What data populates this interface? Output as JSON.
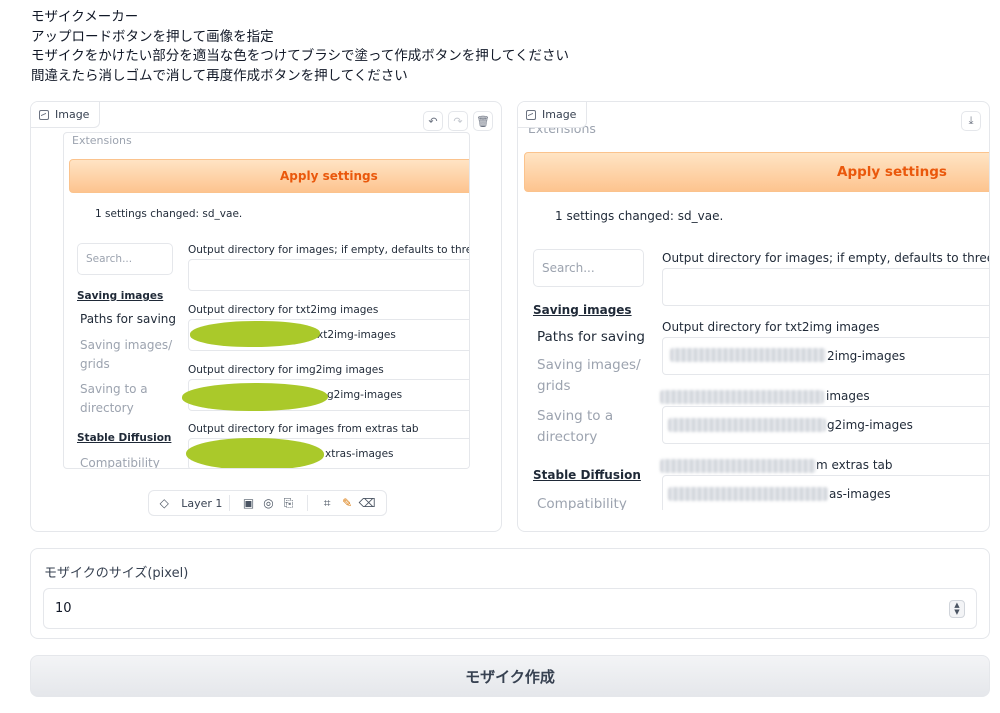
{
  "intro": {
    "line1": "モザイクメーカー",
    "line2": "アップロードボタンを押して画像を指定",
    "line3": "モザイクをかけたい部分を適当な色をつけてブラシで塗って作成ボタンを押してください",
    "line4": "間違えたら消しゴムで消して再度作成ボタンを押してください"
  },
  "input_panel": {
    "label": "Image",
    "icons": [
      "undo-icon",
      "redo-icon",
      "trash-icon"
    ],
    "layer_label": "Layer 1",
    "tools": [
      "layers-icon",
      "image-icon",
      "webcam-icon",
      "clipboard-icon",
      "crop-icon",
      "brush-icon",
      "eraser-icon"
    ]
  },
  "output_panel": {
    "label": "Image",
    "icons": [
      "download-icon"
    ]
  },
  "screenshot": {
    "extensions": "Extensions",
    "apply": "Apply settings",
    "changed": "1 settings changed: sd_vae.",
    "search_placeholder": "Search...",
    "nav_saving_images": "Saving images",
    "nav_paths": "Paths for saving",
    "nav_saving_grids": "Saving images/\ngrids",
    "nav_saving_dir": "Saving to a\ndirectory",
    "nav_stable_diffusion": "Stable Diffusion",
    "nav_compat": "Compatibility",
    "out_dir_label": "Output directory for images; if empty, defaults to three directories below",
    "txt2img_label": "Output directory for txt2img images",
    "txt2img_tail_left": "xt2img-images",
    "txt2img_tail_right": "2img-images",
    "img2img_label": "Output directory for img2img images",
    "img2img_label_tail_right": "images",
    "img2img_tail_left": "g2img-images",
    "img2img_tail_right": "g2img-images",
    "extras_label": "Output directory for images from extras tab",
    "extras_label_tail_right": "m extras tab",
    "extras_tail_left": "xtras-images",
    "extras_tail_right": "as-images"
  },
  "size": {
    "label": "モザイクのサイズ(pixel)",
    "value": "10"
  },
  "make_button": "モザイク作成"
}
